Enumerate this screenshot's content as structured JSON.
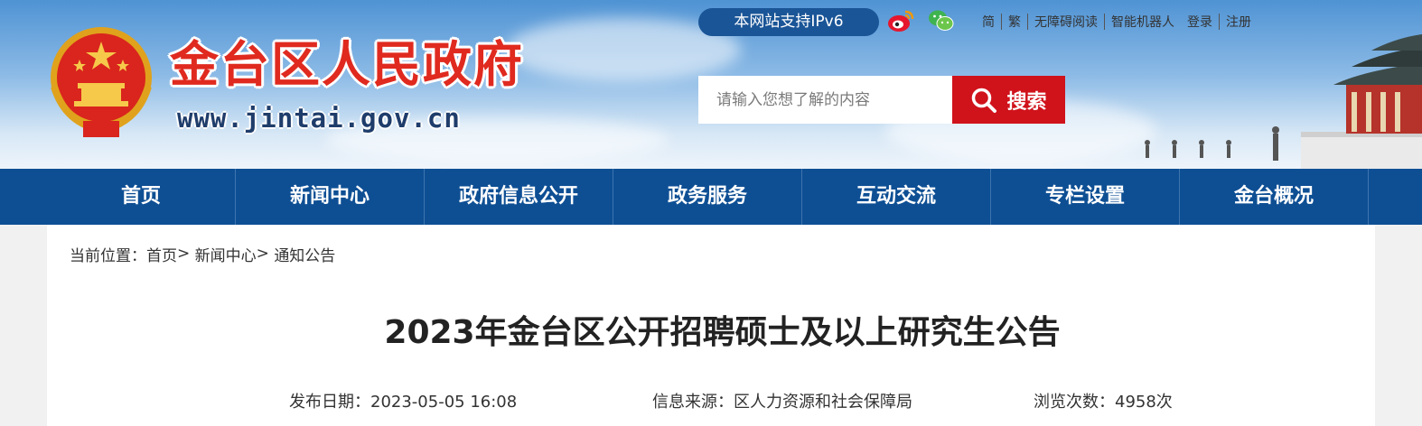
{
  "header": {
    "site_title": "金台区人民政府",
    "site_url": "www.jintai.gov.cn",
    "ipv6_badge": "本网站支持IPv6",
    "social": [
      "weibo-icon",
      "wechat-icon"
    ],
    "top_links": [
      "简",
      "繁",
      "无障碍阅读",
      "智能机器人",
      "登录",
      "注册"
    ],
    "search": {
      "placeholder": "请输入您想了解的内容",
      "button_label": "搜索"
    }
  },
  "nav": {
    "items": [
      "首页",
      "新闻中心",
      "政府信息公开",
      "政务服务",
      "互动交流",
      "专栏设置",
      "金台概况"
    ]
  },
  "breadcrumb": {
    "prefix": "当前位置：",
    "items": [
      "首页",
      "新闻中心",
      "通知公告"
    ],
    "separator": ">"
  },
  "article": {
    "title": "2023年金台区公开招聘硕士及以上研究生公告",
    "publish_label": "发布日期：",
    "publish_date": "2023-05-05 16:08",
    "source_label": "信息来源：",
    "source": "区人力资源和社会保障局",
    "views_label": "浏览次数：",
    "views": "4958次"
  },
  "colors": {
    "nav_bg": "#0e4f94",
    "search_button": "#d0121b",
    "title_red": "#e02a1f",
    "ipv6_badge": "#1a5597"
  }
}
